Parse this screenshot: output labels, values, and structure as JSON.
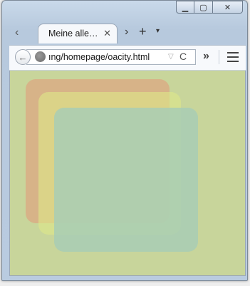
{
  "window": {
    "minimize_glyph": "▁",
    "maximize_glyph": "▢",
    "close_glyph": "✕"
  },
  "tabs": {
    "back_arrow": "‹",
    "active_title": "Meine alle…",
    "close_glyph": "✕",
    "scroll_forward": "›",
    "new_tab": "+",
    "list_tabs": "▾"
  },
  "toolbar": {
    "back_glyph": "←",
    "url": "ıng/homepage/oacity.html",
    "url_dropdown": "▽",
    "reload_glyph": "C",
    "overflow_glyph": "»"
  },
  "content": {
    "background": "#c8d59b",
    "boxes": [
      {
        "name": "red",
        "color": "#e39779"
      },
      {
        "name": "yellow",
        "color": "#dde888"
      },
      {
        "name": "blue",
        "color": "#a8cdb5"
      }
    ]
  }
}
